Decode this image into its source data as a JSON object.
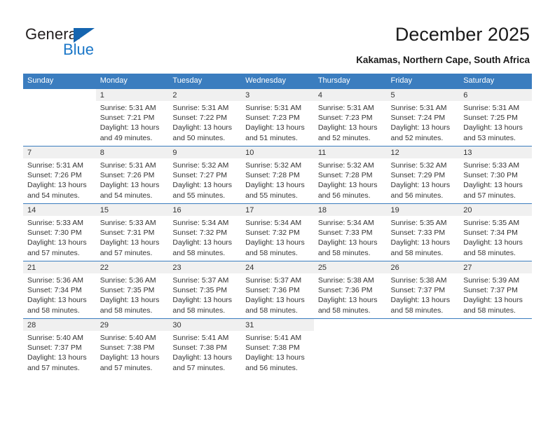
{
  "brand": {
    "name_part1": "General",
    "name_part2": "Blue",
    "accent_color": "#1b77c8",
    "triangle_color": "#1565b0"
  },
  "header": {
    "title": "December 2025",
    "subtitle": "Kakamas, Northern Cape, South Africa"
  },
  "calendar": {
    "header_bg": "#3b7dbf",
    "daynum_bg": "#f0f0f0",
    "weekdays": [
      "Sunday",
      "Monday",
      "Tuesday",
      "Wednesday",
      "Thursday",
      "Friday",
      "Saturday"
    ],
    "labels": {
      "sunrise": "Sunrise:",
      "sunset": "Sunset:",
      "daylight": "Daylight:"
    },
    "weeks": [
      [
        {
          "day": "",
          "blank": true
        },
        {
          "day": "1",
          "sunrise": "Sunrise: 5:31 AM",
          "sunset": "Sunset: 7:21 PM",
          "daylight_l1": "Daylight: 13 hours",
          "daylight_l2": "and 49 minutes."
        },
        {
          "day": "2",
          "sunrise": "Sunrise: 5:31 AM",
          "sunset": "Sunset: 7:22 PM",
          "daylight_l1": "Daylight: 13 hours",
          "daylight_l2": "and 50 minutes."
        },
        {
          "day": "3",
          "sunrise": "Sunrise: 5:31 AM",
          "sunset": "Sunset: 7:23 PM",
          "daylight_l1": "Daylight: 13 hours",
          "daylight_l2": "and 51 minutes."
        },
        {
          "day": "4",
          "sunrise": "Sunrise: 5:31 AM",
          "sunset": "Sunset: 7:23 PM",
          "daylight_l1": "Daylight: 13 hours",
          "daylight_l2": "and 52 minutes."
        },
        {
          "day": "5",
          "sunrise": "Sunrise: 5:31 AM",
          "sunset": "Sunset: 7:24 PM",
          "daylight_l1": "Daylight: 13 hours",
          "daylight_l2": "and 52 minutes."
        },
        {
          "day": "6",
          "sunrise": "Sunrise: 5:31 AM",
          "sunset": "Sunset: 7:25 PM",
          "daylight_l1": "Daylight: 13 hours",
          "daylight_l2": "and 53 minutes."
        }
      ],
      [
        {
          "day": "7",
          "sunrise": "Sunrise: 5:31 AM",
          "sunset": "Sunset: 7:26 PM",
          "daylight_l1": "Daylight: 13 hours",
          "daylight_l2": "and 54 minutes."
        },
        {
          "day": "8",
          "sunrise": "Sunrise: 5:31 AM",
          "sunset": "Sunset: 7:26 PM",
          "daylight_l1": "Daylight: 13 hours",
          "daylight_l2": "and 54 minutes."
        },
        {
          "day": "9",
          "sunrise": "Sunrise: 5:32 AM",
          "sunset": "Sunset: 7:27 PM",
          "daylight_l1": "Daylight: 13 hours",
          "daylight_l2": "and 55 minutes."
        },
        {
          "day": "10",
          "sunrise": "Sunrise: 5:32 AM",
          "sunset": "Sunset: 7:28 PM",
          "daylight_l1": "Daylight: 13 hours",
          "daylight_l2": "and 55 minutes."
        },
        {
          "day": "11",
          "sunrise": "Sunrise: 5:32 AM",
          "sunset": "Sunset: 7:28 PM",
          "daylight_l1": "Daylight: 13 hours",
          "daylight_l2": "and 56 minutes."
        },
        {
          "day": "12",
          "sunrise": "Sunrise: 5:32 AM",
          "sunset": "Sunset: 7:29 PM",
          "daylight_l1": "Daylight: 13 hours",
          "daylight_l2": "and 56 minutes."
        },
        {
          "day": "13",
          "sunrise": "Sunrise: 5:33 AM",
          "sunset": "Sunset: 7:30 PM",
          "daylight_l1": "Daylight: 13 hours",
          "daylight_l2": "and 57 minutes."
        }
      ],
      [
        {
          "day": "14",
          "sunrise": "Sunrise: 5:33 AM",
          "sunset": "Sunset: 7:30 PM",
          "daylight_l1": "Daylight: 13 hours",
          "daylight_l2": "and 57 minutes."
        },
        {
          "day": "15",
          "sunrise": "Sunrise: 5:33 AM",
          "sunset": "Sunset: 7:31 PM",
          "daylight_l1": "Daylight: 13 hours",
          "daylight_l2": "and 57 minutes."
        },
        {
          "day": "16",
          "sunrise": "Sunrise: 5:34 AM",
          "sunset": "Sunset: 7:32 PM",
          "daylight_l1": "Daylight: 13 hours",
          "daylight_l2": "and 58 minutes."
        },
        {
          "day": "17",
          "sunrise": "Sunrise: 5:34 AM",
          "sunset": "Sunset: 7:32 PM",
          "daylight_l1": "Daylight: 13 hours",
          "daylight_l2": "and 58 minutes."
        },
        {
          "day": "18",
          "sunrise": "Sunrise: 5:34 AM",
          "sunset": "Sunset: 7:33 PM",
          "daylight_l1": "Daylight: 13 hours",
          "daylight_l2": "and 58 minutes."
        },
        {
          "day": "19",
          "sunrise": "Sunrise: 5:35 AM",
          "sunset": "Sunset: 7:33 PM",
          "daylight_l1": "Daylight: 13 hours",
          "daylight_l2": "and 58 minutes."
        },
        {
          "day": "20",
          "sunrise": "Sunrise: 5:35 AM",
          "sunset": "Sunset: 7:34 PM",
          "daylight_l1": "Daylight: 13 hours",
          "daylight_l2": "and 58 minutes."
        }
      ],
      [
        {
          "day": "21",
          "sunrise": "Sunrise: 5:36 AM",
          "sunset": "Sunset: 7:34 PM",
          "daylight_l1": "Daylight: 13 hours",
          "daylight_l2": "and 58 minutes."
        },
        {
          "day": "22",
          "sunrise": "Sunrise: 5:36 AM",
          "sunset": "Sunset: 7:35 PM",
          "daylight_l1": "Daylight: 13 hours",
          "daylight_l2": "and 58 minutes."
        },
        {
          "day": "23",
          "sunrise": "Sunrise: 5:37 AM",
          "sunset": "Sunset: 7:35 PM",
          "daylight_l1": "Daylight: 13 hours",
          "daylight_l2": "and 58 minutes."
        },
        {
          "day": "24",
          "sunrise": "Sunrise: 5:37 AM",
          "sunset": "Sunset: 7:36 PM",
          "daylight_l1": "Daylight: 13 hours",
          "daylight_l2": "and 58 minutes."
        },
        {
          "day": "25",
          "sunrise": "Sunrise: 5:38 AM",
          "sunset": "Sunset: 7:36 PM",
          "daylight_l1": "Daylight: 13 hours",
          "daylight_l2": "and 58 minutes."
        },
        {
          "day": "26",
          "sunrise": "Sunrise: 5:38 AM",
          "sunset": "Sunset: 7:37 PM",
          "daylight_l1": "Daylight: 13 hours",
          "daylight_l2": "and 58 minutes."
        },
        {
          "day": "27",
          "sunrise": "Sunrise: 5:39 AM",
          "sunset": "Sunset: 7:37 PM",
          "daylight_l1": "Daylight: 13 hours",
          "daylight_l2": "and 58 minutes."
        }
      ],
      [
        {
          "day": "28",
          "sunrise": "Sunrise: 5:40 AM",
          "sunset": "Sunset: 7:37 PM",
          "daylight_l1": "Daylight: 13 hours",
          "daylight_l2": "and 57 minutes."
        },
        {
          "day": "29",
          "sunrise": "Sunrise: 5:40 AM",
          "sunset": "Sunset: 7:38 PM",
          "daylight_l1": "Daylight: 13 hours",
          "daylight_l2": "and 57 minutes."
        },
        {
          "day": "30",
          "sunrise": "Sunrise: 5:41 AM",
          "sunset": "Sunset: 7:38 PM",
          "daylight_l1": "Daylight: 13 hours",
          "daylight_l2": "and 57 minutes."
        },
        {
          "day": "31",
          "sunrise": "Sunrise: 5:41 AM",
          "sunset": "Sunset: 7:38 PM",
          "daylight_l1": "Daylight: 13 hours",
          "daylight_l2": "and 56 minutes."
        },
        {
          "day": "",
          "blank": true
        },
        {
          "day": "",
          "blank": true
        },
        {
          "day": "",
          "blank": true
        }
      ]
    ]
  }
}
